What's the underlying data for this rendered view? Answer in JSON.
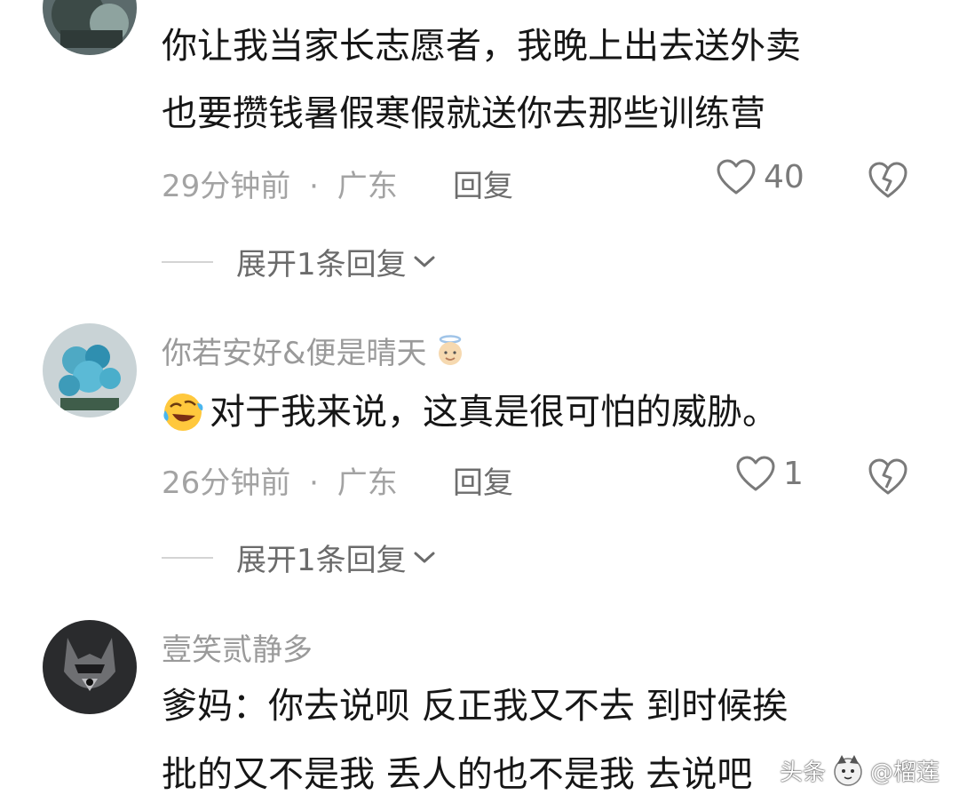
{
  "comments": [
    {
      "username": "",
      "text_lines": [
        "你让我当家长志愿者，我晚上出去送外卖",
        "也要攒钱暑假寒假就送你去那些训练营"
      ],
      "time": "29分钟前",
      "location": "广东",
      "separator": "·",
      "reply_label": "回复",
      "likes": "40",
      "expand_label": "展开1条回复"
    },
    {
      "username": "你若安好&便是晴天",
      "text_lines": [
        "对于我来说，这真是很可怕的威胁。"
      ],
      "time": "26分钟前",
      "location": "广东",
      "separator": "·",
      "reply_label": "回复",
      "likes": "1",
      "expand_label": "展开1条回复"
    },
    {
      "username": "壹笑贰静多",
      "text_lines": [
        "爹妈：你去说呗  反正我又不去  到时候挨",
        "批的又不是我  丢人的也不是我  去说吧"
      ]
    }
  ],
  "watermark": {
    "brand": "头条",
    "author": "@榴莲"
  },
  "colors": {
    "meta_text": "#a3a3a3",
    "body_text": "#161616",
    "icon_gray": "#7a7a7a"
  }
}
